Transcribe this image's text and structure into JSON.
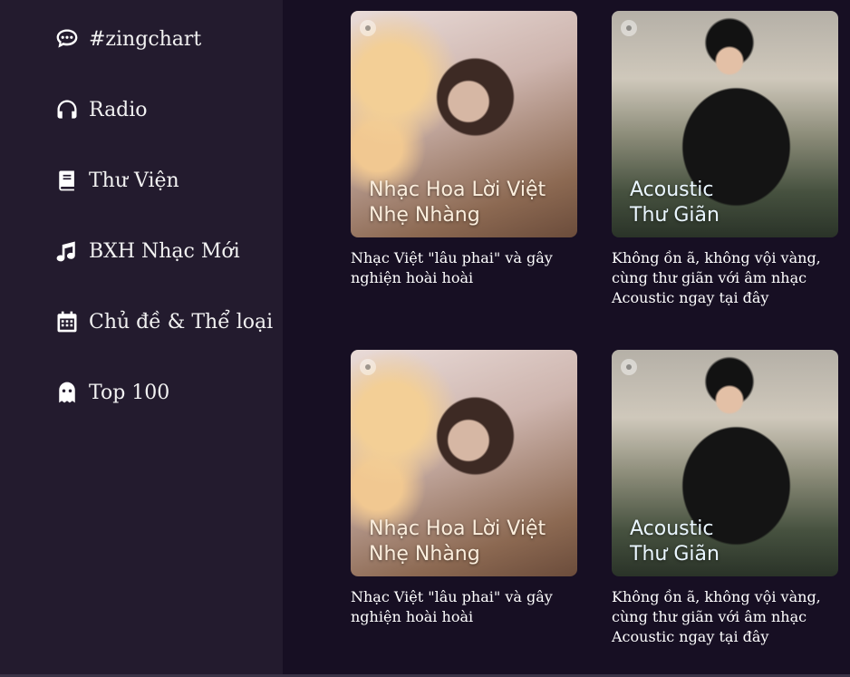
{
  "sidebar": {
    "items": [
      {
        "label": "#zingchart",
        "icon": "chat-icon"
      },
      {
        "label": "Radio",
        "icon": "headphones-icon"
      },
      {
        "label": "Thư Viện",
        "icon": "book-icon"
      },
      {
        "label": "BXH Nhạc Mới",
        "icon": "music-note-icon"
      },
      {
        "label": "Chủ đề & Thể loại",
        "icon": "calendar-icon"
      },
      {
        "label": "Top 100",
        "icon": "ghost-icon"
      }
    ]
  },
  "playlists": [
    {
      "thumb_title": "Nhạc Hoa Lời Việt\nNhẹ Nhàng",
      "description": "Nhạc Việt \"lâu phai\" và gây nghiện hoài hoài"
    },
    {
      "thumb_title": "Acoustic\nThư Giãn",
      "description": "Không ồn ã, không vội vàng, cùng thư giãn với âm nhạc Acoustic ngay tại đây"
    },
    {
      "thumb_title": "Nhạc Hoa Lời Việt\nNhẹ Nhàng",
      "description": "Nhạc Việt \"lâu phai\" và gây nghiện hoài hoài"
    },
    {
      "thumb_title": "Acoustic\nThư Giãn",
      "description": "Không ồn ã, không vội vàng, cùng thư giãn với âm nhạc Acoustic ngay tại đây"
    }
  ],
  "colors": {
    "sidebar_bg": "#231b2e",
    "main_bg": "#170f23",
    "text": "#ffffff"
  }
}
